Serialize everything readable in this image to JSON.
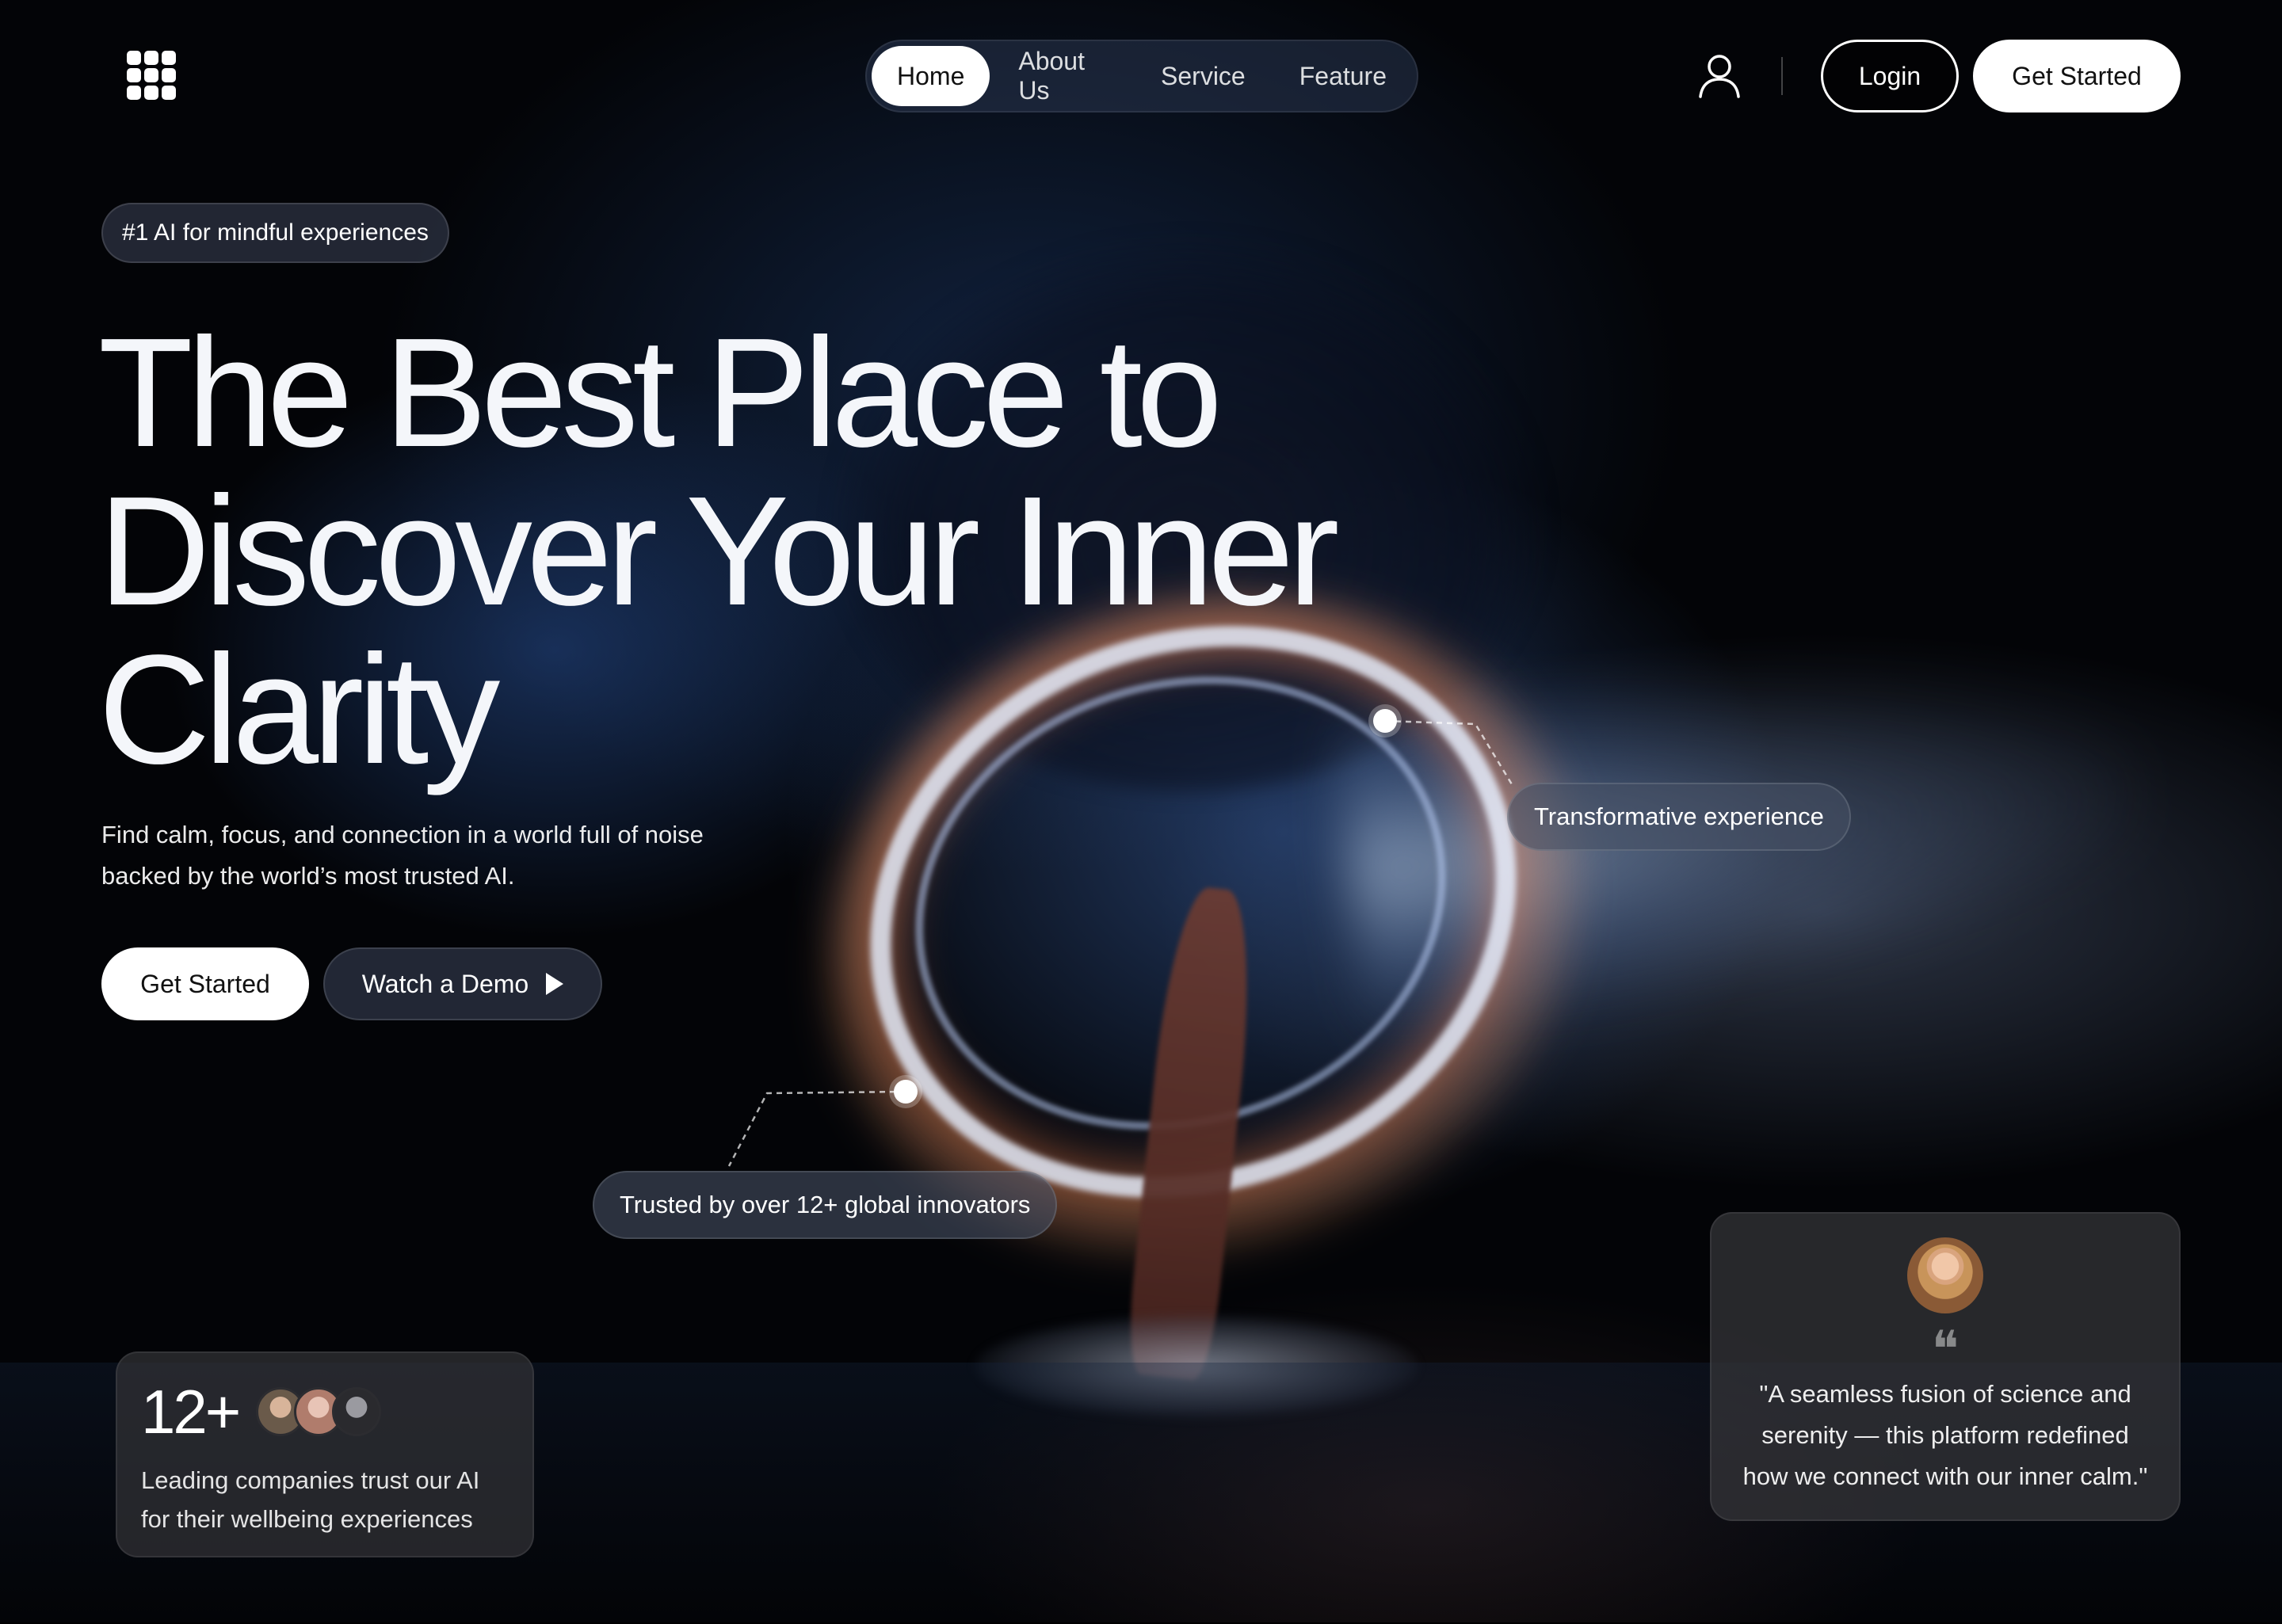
{
  "nav": {
    "items": [
      {
        "label": "Home",
        "active": true
      },
      {
        "label": "About Us"
      },
      {
        "label": "Service"
      },
      {
        "label": "Feature"
      }
    ],
    "login_label": "Login",
    "get_started_label": "Get Started",
    "user_icon": "user-icon",
    "logo_icon": "grid-logo-icon"
  },
  "hero": {
    "tag": "#1 AI for mindful experiences",
    "headline_lines": [
      "The Best Place to",
      "Discover Your Inner",
      "Clarity"
    ],
    "subtext_lines": [
      "Find calm, focus, and connection in a world full of noise",
      "backed by the world’s most trusted AI."
    ],
    "cta_primary": "Get Started",
    "cta_secondary": "Watch a Demo",
    "cta_secondary_icon": "play-icon"
  },
  "callouts": {
    "right": "Transformative experience",
    "left": "Trusted by over 12+ global innovators"
  },
  "stat_card": {
    "number": "12+",
    "text_lines": [
      "Leading companies trust our AI",
      "for their wellbeing experiences"
    ]
  },
  "testimonial": {
    "quote_icon": "quote-icon",
    "text_lines": [
      "\"A seamless fusion of science and",
      "serenity — this platform redefined",
      "how we connect with our inner calm.\""
    ]
  },
  "colors": {
    "background": "#030407",
    "accent": "#ffffff",
    "glow": "#ff9a64"
  }
}
